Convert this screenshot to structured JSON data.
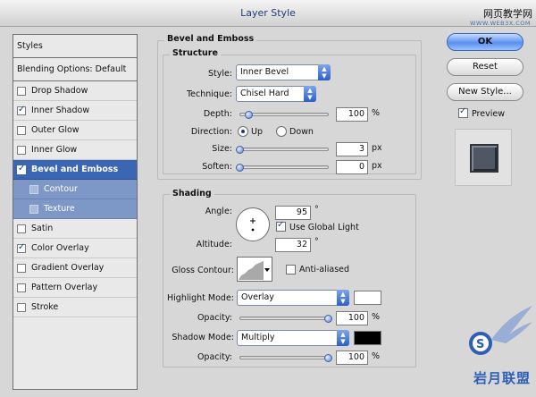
{
  "window": {
    "title": "Layer Style",
    "watermark_top": "网页教学网",
    "watermark_url": "WWW.WEB3X.COM",
    "watermark_bottom": "岩月联盟"
  },
  "styles_panel": {
    "header": "Styles",
    "blending": "Blending Options: Default",
    "items": [
      {
        "label": "Drop Shadow",
        "checked": false
      },
      {
        "label": "Inner Shadow",
        "checked": true
      },
      {
        "label": "Outer Glow",
        "checked": false
      },
      {
        "label": "Inner Glow",
        "checked": false
      },
      {
        "label": "Bevel and Emboss",
        "checked": true,
        "active": true
      },
      {
        "label": "Contour",
        "checked": false,
        "sub": true
      },
      {
        "label": "Texture",
        "checked": false,
        "sub": true
      },
      {
        "label": "Satin",
        "checked": false
      },
      {
        "label": "Color Overlay",
        "checked": true
      },
      {
        "label": "Gradient Overlay",
        "checked": false
      },
      {
        "label": "Pattern Overlay",
        "checked": false
      },
      {
        "label": "Stroke",
        "checked": false
      }
    ]
  },
  "bevel": {
    "section_title": "Bevel and Emboss",
    "structure_title": "Structure",
    "style_label": "Style:",
    "style_value": "Inner Bevel",
    "technique_label": "Technique:",
    "technique_value": "Chisel Hard",
    "depth_label": "Depth:",
    "depth_value": "100",
    "depth_unit": "%",
    "direction_label": "Direction:",
    "direction_up": "Up",
    "direction_down": "Down",
    "direction_selected": "Up",
    "size_label": "Size:",
    "size_value": "3",
    "size_unit": "px",
    "soften_label": "Soften:",
    "soften_value": "0",
    "soften_unit": "px"
  },
  "shading": {
    "title": "Shading",
    "angle_label": "Angle:",
    "angle_value": "95",
    "angle_unit": "°",
    "global_light_label": "Use Global Light",
    "global_light_checked": true,
    "altitude_label": "Altitude:",
    "altitude_value": "32",
    "altitude_unit": "°",
    "gloss_label": "Gloss Contour:",
    "anti_aliased_label": "Anti-aliased",
    "anti_aliased_checked": false,
    "highlight_label": "Highlight Mode:",
    "highlight_value": "Overlay",
    "highlight_color": "#ffffff",
    "highlight_opacity_label": "Opacity:",
    "highlight_opacity": "100",
    "highlight_opacity_unit": "%",
    "shadow_label": "Shadow Mode:",
    "shadow_value": "Multiply",
    "shadow_color": "#000000",
    "shadow_opacity_label": "Opacity:",
    "shadow_opacity": "100",
    "shadow_opacity_unit": "%"
  },
  "buttons": {
    "ok": "OK",
    "reset": "Reset",
    "new_style": "New Style...",
    "preview": "Preview",
    "preview_checked": true
  },
  "colors": {
    "accent": "#3a66b4",
    "sub_row": "#7d97c6",
    "preview_swatch": "#4e5763"
  }
}
